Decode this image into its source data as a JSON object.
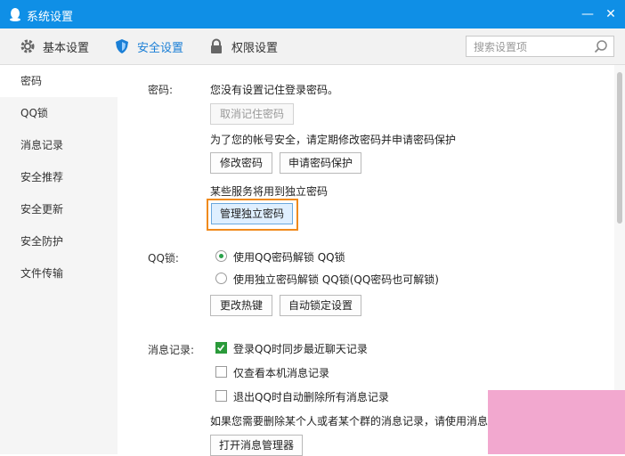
{
  "window": {
    "title": "系统设置",
    "minimize": "—",
    "close": "✕"
  },
  "tabs": [
    {
      "label": "基本设置",
      "icon": "gear-icon"
    },
    {
      "label": "安全设置",
      "icon": "shield-icon"
    },
    {
      "label": "权限设置",
      "icon": "lock-icon"
    }
  ],
  "search": {
    "placeholder": "搜索设置项"
  },
  "sidebar": {
    "items": [
      "密码",
      "QQ锁",
      "消息记录",
      "安全推荐",
      "安全更新",
      "安全防护",
      "文件传输"
    ]
  },
  "password": {
    "label": "密码:",
    "no_saved": "您没有设置记住登录密码。",
    "cancel_remember": "取消记住密码",
    "hint": "为了您的帐号安全，请定期修改密码并申请密码保护",
    "change": "修改密码",
    "apply_protection": "申请密码保护",
    "independent_hint": "某些服务将用到独立密码",
    "manage_independent": "管理独立密码"
  },
  "qqlock": {
    "label": "QQ锁:",
    "option1": "使用QQ密码解锁 QQ锁",
    "option2": "使用独立密码解锁 QQ锁(QQ密码也可解锁)",
    "selected": "option1",
    "change_hotkey": "更改热键",
    "auto_lock": "自动锁定设置"
  },
  "msglog": {
    "label": "消息记录:",
    "sync": "登录QQ时同步最近聊天记录",
    "local_only": "仅查看本机消息记录",
    "auto_delete": "退出QQ时自动删除所有消息记录",
    "checked": "sync",
    "delete_hint": "如果您需要删除某个人或者某个群的消息记录，请使用消息",
    "open_manager": "打开消息管理器"
  },
  "colors": {
    "titlebar": "#0f8fe6",
    "accent": "#1a7fd6",
    "highlight": "#f08a1c",
    "check": "#2a9a3a"
  }
}
